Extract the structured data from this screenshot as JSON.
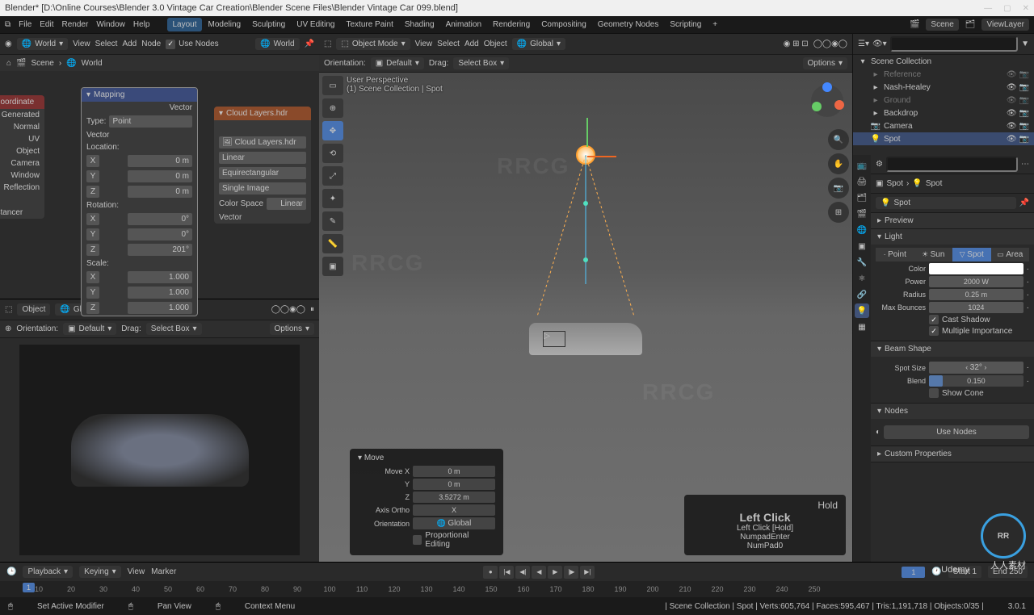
{
  "title": "Blender* [D:\\Online Courses\\Blender 3.0 Vintage Car Creation\\Blender Scene Files\\Blender Vintage Car 099.blend]",
  "window_buttons": {
    "min": "—",
    "max": "▢",
    "close": "✕"
  },
  "menubar": {
    "logo": "⧉",
    "items": [
      "File",
      "Edit",
      "Render",
      "Window",
      "Help"
    ],
    "scene": "Scene",
    "viewlayer": "ViewLayer"
  },
  "workspaces": [
    "Layout",
    "Modeling",
    "Sculpting",
    "UV Editing",
    "Texture Paint",
    "Shading",
    "Animation",
    "Rendering",
    "Compositing",
    "Geometry Nodes",
    "Scripting",
    "+"
  ],
  "workspace_active": "Layout",
  "shader_header": {
    "world_dd": "World",
    "menus": [
      "View",
      "Select",
      "Add",
      "Node"
    ],
    "use_nodes": "Use Nodes",
    "world_slot": "World"
  },
  "shader_crumb": {
    "scene": "Scene",
    "world": "World"
  },
  "node_tex": {
    "title": "ure Coordinate",
    "outputs": [
      "Generated",
      "Normal",
      "UV",
      "Object",
      "Camera",
      "Window",
      "Reflection"
    ],
    "instancer": "m Instancer"
  },
  "node_mapping": {
    "title": "Mapping",
    "top_out": "Vector",
    "type_lab": "Type:",
    "type_val": "Point",
    "vec_lab": "Vector",
    "loc_lab": "Location:",
    "rot_lab": "Rotation:",
    "scale_lab": "Scale:",
    "loc": [
      {
        "ax": "X",
        "val": "0 m"
      },
      {
        "ax": "Y",
        "val": "0 m"
      },
      {
        "ax": "Z",
        "val": "0 m"
      }
    ],
    "rot": [
      {
        "ax": "X",
        "val": "0°"
      },
      {
        "ax": "Y",
        "val": "0°"
      },
      {
        "ax": "Z",
        "val": "201°"
      }
    ],
    "scale": [
      {
        "ax": "X",
        "val": "1.000"
      },
      {
        "ax": "Y",
        "val": "1.000"
      },
      {
        "ax": "Z",
        "val": "1.000"
      }
    ]
  },
  "node_env": {
    "title": "Cloud Layers.hdr",
    "image": "Cloud Layers.hdr",
    "interp": "Linear",
    "proj": "Equirectangular",
    "single": "Single Image",
    "cs_lab": "Color Space",
    "cs_val": "Linear",
    "vec": "Vector"
  },
  "lower_header": {
    "mode": "Object",
    "orient": "Global"
  },
  "lower_sub": {
    "orient_lab": "Orientation:",
    "orient_val": "Default",
    "drag": "Drag:",
    "drag_val": "Select Box",
    "options": "Options"
  },
  "vp_header": {
    "mode": "Object Mode",
    "menus": [
      "View",
      "Select",
      "Add",
      "Object"
    ],
    "orient": "Global"
  },
  "vp_sub": {
    "orient_lab": "Orientation:",
    "orient_val": "Default",
    "drag": "Drag:",
    "drag_val": "Select Box",
    "options": "Options"
  },
  "vp_overlay": {
    "line1": "User Perspective",
    "line2": "(1) Scene Collection | Spot"
  },
  "move_panel": {
    "title": "Move",
    "rows": [
      {
        "lab": "Move X",
        "val": "0 m"
      },
      {
        "lab": "Y",
        "val": "0 m"
      },
      {
        "lab": "Z",
        "val": "3.5272 m"
      }
    ],
    "axis_lab": "Axis Ortho",
    "axis_val": "X",
    "orient_lab": "Orientation",
    "orient_val": "Global",
    "prop": "Proportional Editing"
  },
  "key_panel": {
    "hold": "Hold",
    "title": "Left Click",
    "lines": [
      "Left Click [Hold]",
      "NumpadEnter",
      "NumPad0"
    ]
  },
  "outliner": {
    "root": "Scene Collection",
    "items": [
      {
        "icon": "▸",
        "label": "Reference",
        "ind": 1,
        "sel": false,
        "dim": true
      },
      {
        "icon": "▸",
        "label": "Nash-Healey",
        "ind": 1,
        "sel": false
      },
      {
        "icon": "▸",
        "label": "Ground",
        "ind": 1,
        "sel": false,
        "dim": true
      },
      {
        "icon": "▸",
        "label": "Backdrop",
        "ind": 1,
        "sel": false
      },
      {
        "icon": "📷",
        "label": "Camera",
        "ind": 1,
        "sel": false
      },
      {
        "icon": "💡",
        "label": "Spot",
        "ind": 1,
        "sel": true
      }
    ]
  },
  "props_crumb": {
    "a": "Spot",
    "b": "Spot"
  },
  "props_slot": "Spot",
  "preview_lab": "Preview",
  "light_panel": {
    "title": "Light",
    "types": [
      "Point",
      "Sun",
      "Spot",
      "Area"
    ],
    "active": "Spot",
    "color_lab": "Color",
    "power_lab": "Power",
    "power_val": "2000 W",
    "radius_lab": "Radius",
    "radius_val": "0.25 m",
    "bounces_lab": "Max Bounces",
    "bounces_val": "1024",
    "cast": "Cast Shadow",
    "multi": "Multiple Importance"
  },
  "beam_panel": {
    "title": "Beam Shape",
    "size_lab": "Spot Size",
    "size_val": "32°",
    "blend_lab": "Blend",
    "blend_val": "0.150",
    "blend_pct": 15,
    "cone": "Show Cone"
  },
  "nodes_panel": {
    "title": "Nodes",
    "btn": "Use Nodes"
  },
  "custom_panel": "Custom Properties",
  "timeline": {
    "playback": "Playback",
    "keying": "Keying",
    "view": "View",
    "marker": "Marker",
    "cur": "1",
    "start_lab": "Start",
    "start": "1",
    "end_lab": "End",
    "end": "250",
    "ticks": [
      "10",
      "20",
      "30",
      "40",
      "50",
      "60",
      "70",
      "80",
      "90",
      "100",
      "110",
      "120",
      "130",
      "140",
      "150",
      "160",
      "170",
      "180",
      "190",
      "200",
      "210",
      "220",
      "230",
      "240",
      "250"
    ]
  },
  "status": {
    "left1": "Set Active Modifier",
    "left2": "Pan View",
    "left3": "Context Menu",
    "right": "| Scene Collection | Spot | Verts:605,764 | Faces:595,467 | Tris:1,191,718 | Objects:0/35 |",
    "ver": "3.0.1"
  },
  "branding": {
    "wm": "RRCG",
    "logo": "RR",
    "tag": "人人素材",
    "udemy": "Udemy"
  }
}
